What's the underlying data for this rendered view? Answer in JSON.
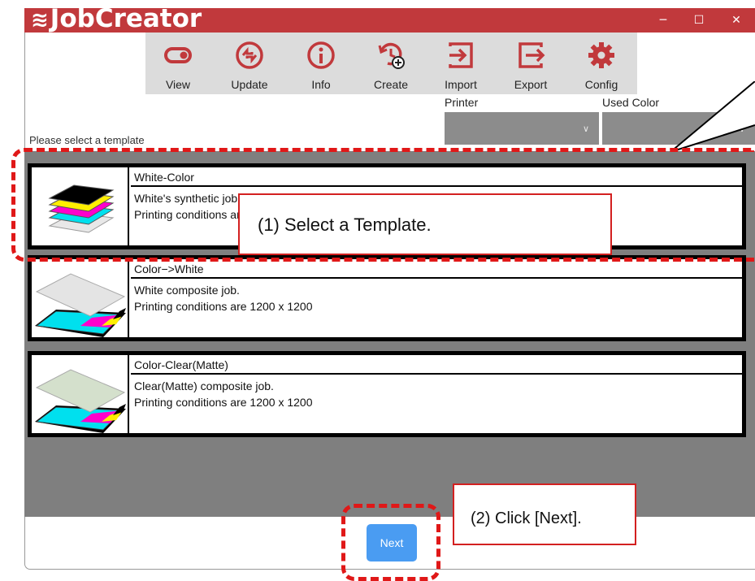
{
  "app": {
    "title": "JobCreator",
    "window_controls": {
      "minimize": "─",
      "maximize": "☐",
      "close": "✕"
    }
  },
  "toolbar": {
    "items": [
      {
        "label": "View",
        "icon": "toggle-icon"
      },
      {
        "label": "Update",
        "icon": "update-icon"
      },
      {
        "label": "Info",
        "icon": "info-icon"
      },
      {
        "label": "Create",
        "icon": "create-icon"
      },
      {
        "label": "Import",
        "icon": "import-icon"
      },
      {
        "label": "Export",
        "icon": "export-icon"
      },
      {
        "label": "Config",
        "icon": "gear-icon"
      }
    ]
  },
  "filters": {
    "printer_label": "Printer",
    "printer_value": "",
    "used_color_label": "Used Color",
    "used_color_value": ""
  },
  "hint": "Please select a template",
  "templates": [
    {
      "name": "White-Color",
      "line1": "White's synthetic job.",
      "line2": "Printing conditions are 1200 x 1200"
    },
    {
      "name": "Color−>White",
      "line1": "White composite job.",
      "line2": "Printing conditions are 1200 x 1200"
    },
    {
      "name": "Color-Clear(Matte)",
      "line1": "Clear(Matte) composite job.",
      "line2": "Printing conditions are 1200 x 1200"
    }
  ],
  "footer": {
    "next_label": "Next"
  },
  "annotations": {
    "step1": "(1) Select a Template.",
    "step2": "(2) Click [Next]."
  },
  "colors": {
    "titlebar": "#c1393c",
    "toolbar_icon": "#c1393c",
    "next_button": "#4a9cf2",
    "highlight": "#e01818"
  }
}
